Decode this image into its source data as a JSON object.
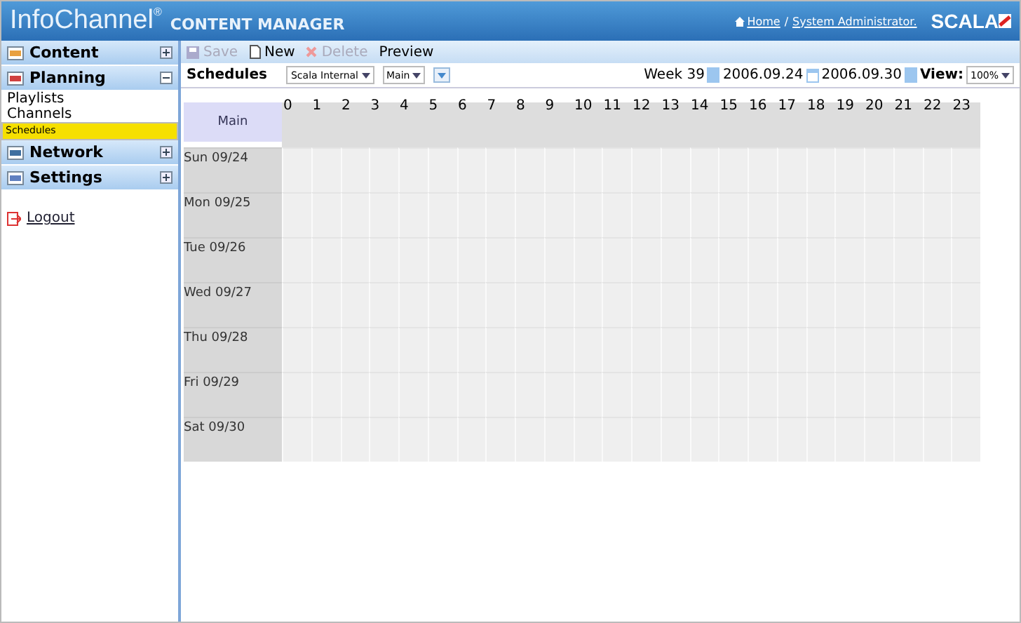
{
  "header": {
    "brand": "InfoChannel",
    "brand_mark": "®",
    "product": "CONTENT MANAGER",
    "links": [
      "Home",
      "System Administrator."
    ],
    "separator": "/",
    "logo": "SCALA"
  },
  "sidebar": {
    "sections": [
      {
        "label": "Content",
        "expanded": false
      },
      {
        "label": "Planning",
        "expanded": true,
        "items": [
          {
            "label": "Playlists",
            "selected": false
          },
          {
            "label": "Channels",
            "selected": false
          },
          {
            "label": "Schedules",
            "selected": true
          }
        ]
      },
      {
        "label": "Network",
        "expanded": false
      },
      {
        "label": "Settings",
        "expanded": false
      }
    ],
    "logout": "Logout"
  },
  "toolbar": [
    {
      "label": "Save",
      "disabled": true,
      "kind": "save"
    },
    {
      "label": "New",
      "disabled": false,
      "kind": "new"
    },
    {
      "label": "Delete",
      "disabled": true,
      "kind": "delete"
    },
    {
      "label": "Preview",
      "disabled": false,
      "kind": "plain"
    }
  ],
  "filter_bar": {
    "title": "Schedules",
    "selects": [
      "Scala Internal",
      "Main"
    ],
    "week": "Week 39",
    "start": "2006.09.24",
    "end": "2006.09.30",
    "view_label": "View:",
    "zoom": "100%"
  },
  "schedule": {
    "corner": "Main",
    "hours": [
      "0",
      "1",
      "2",
      "3",
      "4",
      "5",
      "6",
      "7",
      "8",
      "9",
      "10",
      "11",
      "12",
      "13",
      "14",
      "15",
      "16",
      "17",
      "18",
      "19",
      "20",
      "21",
      "22",
      "23"
    ],
    "days": [
      "Sun 09/24",
      "Mon 09/25",
      "Tue 09/26",
      "Wed 09/27",
      "Thu 09/28",
      "Fri 09/29",
      "Sat 09/30"
    ]
  }
}
